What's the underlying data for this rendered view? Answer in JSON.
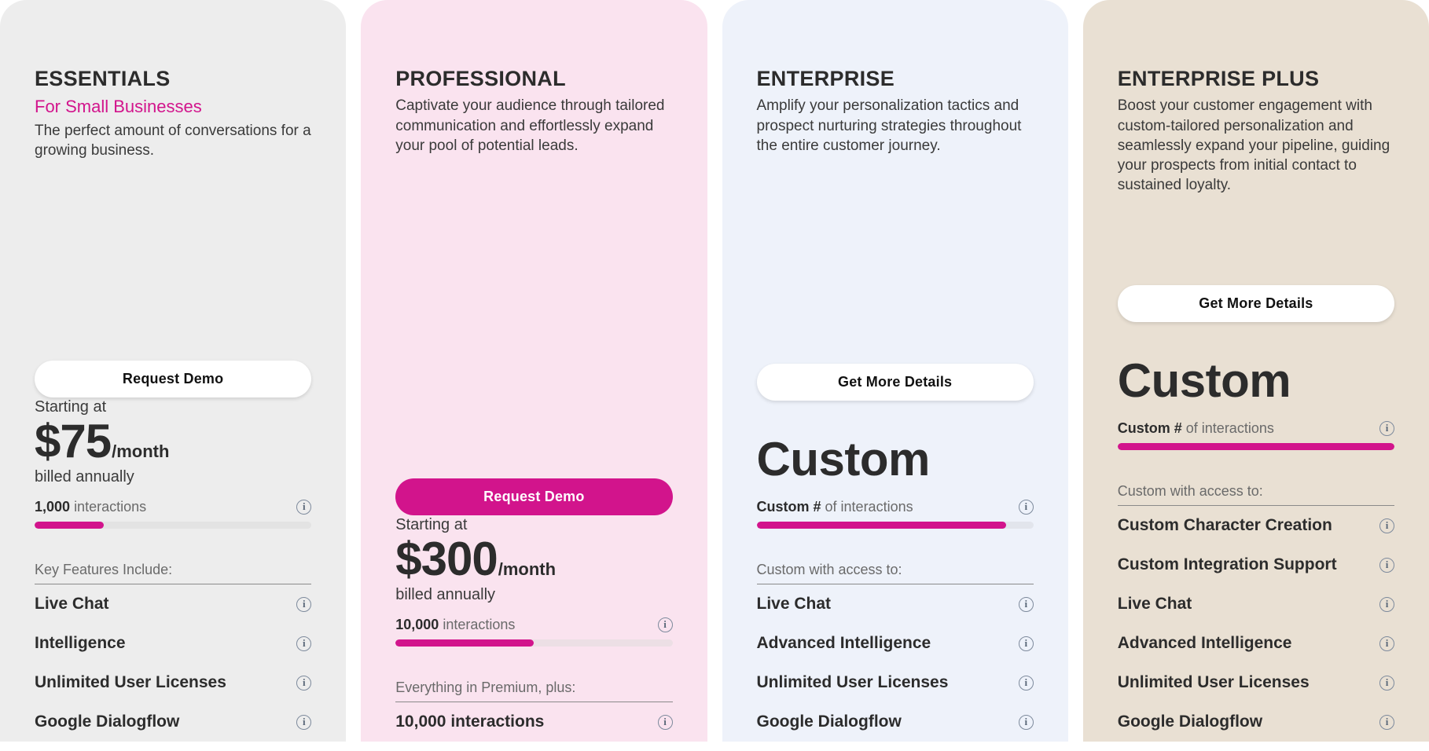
{
  "theme": {
    "accent": "#d2148c",
    "text_dark": "#2c2c2c",
    "text_muted": "#6a6a6a"
  },
  "info_icon_glyph": "i",
  "plans": [
    {
      "name": "ESSENTIALS",
      "tagline": "For Small Businesses",
      "description": "The perfect amount of conversations for a growing business.",
      "cta_label": "Request Demo",
      "cta_style": "light",
      "background": "#ededed",
      "price": {
        "prefix": "Starting at",
        "amount": "$75",
        "period": "/month",
        "billing_note": "billed annually",
        "is_custom": false
      },
      "usage": {
        "value": "1,000",
        "unit": "interactions",
        "fill_percent": 25
      },
      "features_heading": "Key Features Include:",
      "features": [
        "Live Chat",
        "Intelligence",
        "Unlimited User Licenses",
        "Google Dialogflow"
      ]
    },
    {
      "name": "PROFESSIONAL",
      "tagline": "",
      "description": "Captivate your audience through tailored communication and effortlessly expand your pool of potential leads.",
      "cta_label": "Request Demo",
      "cta_style": "accent",
      "background": "#fae3ef",
      "price": {
        "prefix": "Starting at",
        "amount": "$300",
        "period": "/month",
        "billing_note": "billed annually",
        "is_custom": false
      },
      "usage": {
        "value": "10,000",
        "unit": "interactions",
        "fill_percent": 50
      },
      "features_heading": "Everything in Premium, plus:",
      "features": [
        "10,000 interactions"
      ]
    },
    {
      "name": "ENTERPRISE",
      "tagline": "",
      "description": "Amplify your personalization tactics and prospect nurturing strategies throughout the entire customer journey.",
      "cta_label": "Get More Details",
      "cta_style": "light",
      "background": "#eef2fa",
      "price": {
        "prefix": "",
        "amount": "Custom",
        "period": "",
        "billing_note": "",
        "is_custom": true
      },
      "usage": {
        "value": "Custom #",
        "unit": "of interactions",
        "fill_percent": 90
      },
      "features_heading": "Custom with access to:",
      "features": [
        "Live Chat",
        "Advanced Intelligence",
        "Unlimited User Licenses",
        "Google Dialogflow"
      ]
    },
    {
      "name": "ENTERPRISE PLUS",
      "tagline": "",
      "description": "Boost your customer engagement with custom-tailored personalization and seamlessly expand your pipeline, guiding your prospects from initial contact to sustained loyalty.",
      "cta_label": "Get More Details",
      "cta_style": "light",
      "background": "#e9e0d3",
      "price": {
        "prefix": "",
        "amount": "Custom",
        "period": "",
        "billing_note": "",
        "is_custom": true
      },
      "usage": {
        "value": "Custom #",
        "unit": "of interactions",
        "fill_percent": 100
      },
      "features_heading": "Custom with access to:",
      "features": [
        "Custom Character Creation",
        "Custom Integration Support",
        "Live Chat",
        "Advanced Intelligence",
        "Unlimited User Licenses",
        "Google Dialogflow"
      ]
    }
  ]
}
